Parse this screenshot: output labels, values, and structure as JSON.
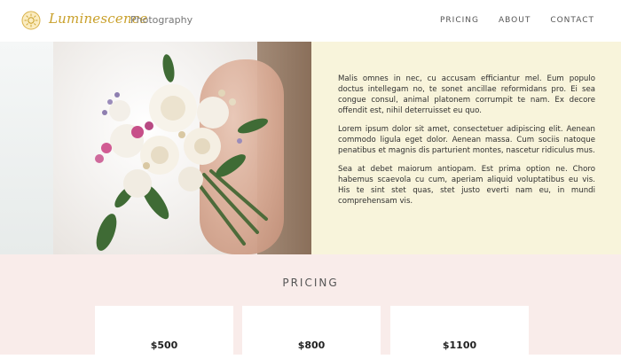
{
  "header": {
    "brand_name": "Luminescence",
    "brand_subtitle": "Photography",
    "logo_icon": "sun-icon",
    "nav": [
      {
        "label": "PRICING"
      },
      {
        "label": "ABOUT"
      },
      {
        "label": "CONTACT"
      }
    ]
  },
  "hero": {
    "image_subject": "bride-bouquet-photo",
    "paragraphs": [
      "Malis omnes in nec, cu accusam efficiantur mel. Eum populo doctus intellegam no, te sonet ancillae reformidans pro. Ei sea congue consul, animal platonem corrumpit te nam. Ex decore offendit est, nihil deterruisset eu quo.",
      "Lorem ipsum dolor sit amet, consectetuer adipiscing elit. Aenean commodo ligula eget dolor. Aenean massa. Cum sociis natoque penatibus et magnis dis parturient montes, nascetur ridiculus mus.",
      "Sea at debet maiorum antiopam. Est prima option ne. Choro habemus scaevola cu cum, aperiam aliquid voluptatibus eu vis. His te sint stet quas, stet justo everti nam eu, in mundi comprehensam vis."
    ]
  },
  "pricing": {
    "title": "PRICING",
    "plans": [
      {
        "price": "$500"
      },
      {
        "price": "$800"
      },
      {
        "price": "$1100"
      }
    ]
  },
  "colors": {
    "brand_gold": "#c9a02a",
    "text_panel_bg": "#f8f4db",
    "pricing_bg": "#f9ecea"
  }
}
